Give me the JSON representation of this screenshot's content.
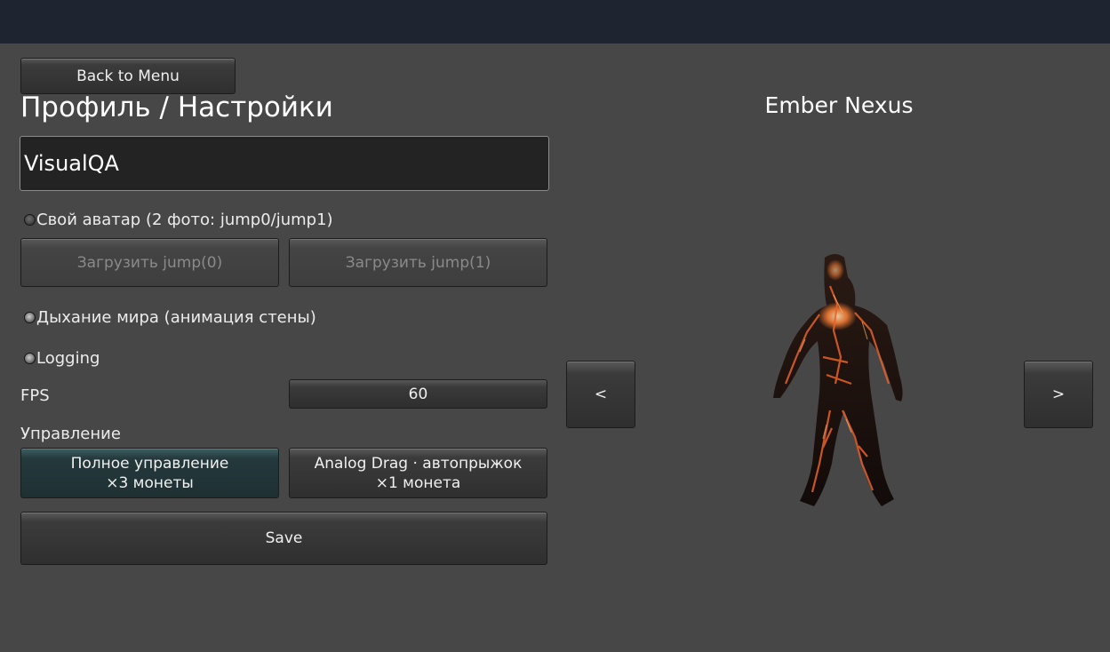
{
  "header": {
    "back_label": "Back to Menu",
    "title": "Профиль / Настройки"
  },
  "profile": {
    "name_value": "VisualQA"
  },
  "avatar": {
    "toggle_label": "Свой аватар (2 фото: jump0/jump1)",
    "toggle_on": false,
    "upload0_label": "Загрузить jump(0)",
    "upload1_label": "Загрузить jump(1)"
  },
  "world_breath": {
    "label": "Дыхание мира (анимация стены)",
    "on": true
  },
  "logging": {
    "label": "Logging",
    "on": true
  },
  "fps": {
    "label": "FPS",
    "value": "60"
  },
  "controls": {
    "label": "Управление",
    "options": [
      {
        "line1": "Полное управление",
        "line2": "×3 монеты",
        "selected": true
      },
      {
        "line1": "Analog Drag · автопрыжок",
        "line2": "×1 монета",
        "selected": false
      }
    ]
  },
  "save_label": "Save",
  "character": {
    "name": "Ember Nexus",
    "prev_label": "<",
    "next_label": ">"
  },
  "colors": {
    "background": "#474747",
    "topbar": "#1e2430",
    "selected": "#24393c",
    "ember": "#e8622a"
  }
}
